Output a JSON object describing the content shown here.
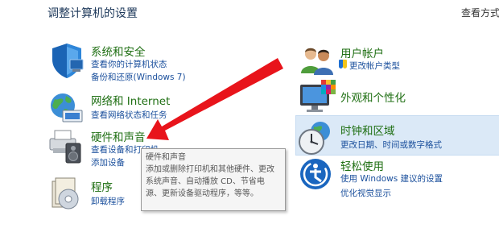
{
  "header": {
    "title": "调整计算机的设置",
    "view_by": "查看方式"
  },
  "left_categories": [
    {
      "title": "系统和安全",
      "icon": "shield-system-icon",
      "links": [
        "查看你的计算机状态",
        "备份和还原(Windows 7)"
      ]
    },
    {
      "title": "网络和 Internet",
      "icon": "globe-network-icon",
      "links": [
        "查看网络状态和任务"
      ]
    },
    {
      "title": "硬件和声音",
      "icon": "printer-speaker-icon",
      "links": [
        "查看设备和打印机",
        "添加设备"
      ]
    },
    {
      "title": "程序",
      "icon": "programs-disk-icon",
      "links": [
        "卸载程序"
      ]
    }
  ],
  "right_categories": [
    {
      "title": "用户帐户",
      "icon": "users-icon",
      "links": [
        "更改帐户类型"
      ]
    },
    {
      "title": "外观和个性化",
      "icon": "monitor-palette-icon",
      "links": []
    },
    {
      "title": "时钟和区域",
      "icon": "clock-globe-icon",
      "links": [
        "更改日期、时间或数字格式"
      ]
    },
    {
      "title": "轻松使用",
      "icon": "ease-of-access-icon",
      "links": [
        "使用 Windows 建议的设置",
        "优化视觉显示"
      ]
    }
  ],
  "tooltip": {
    "lines": [
      "硬件和声音",
      "添加或删除打印机和其他硬件、更改",
      "系统声音、自动播放 CD、节省电",
      "源、更新设备驱动程序，等等。"
    ]
  },
  "colors": {
    "category_title": "#1f6f13",
    "link": "#1a4f9c",
    "arrow": "#e8141b",
    "hover_bg": "#dbe9f7"
  }
}
